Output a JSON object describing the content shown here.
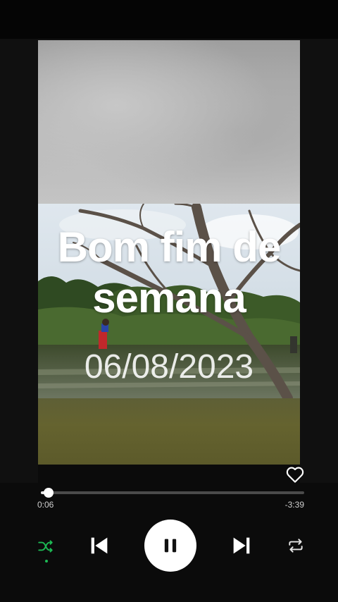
{
  "story": {
    "title": "Bom fim de semana",
    "date": "06/08/2023"
  },
  "player": {
    "elapsed": "0:06",
    "remaining": "-3:39",
    "progress_fraction": 0.03,
    "shuffle_active": true
  },
  "icons": {
    "like": "heart-outline-icon",
    "shuffle": "shuffle-icon",
    "previous": "skip-previous-icon",
    "play_pause": "pause-icon",
    "next": "skip-next-icon",
    "repeat": "repeat-icon"
  },
  "colors": {
    "background": "#0b0b0b",
    "accent": "#1db954",
    "text": "#ffffff"
  }
}
